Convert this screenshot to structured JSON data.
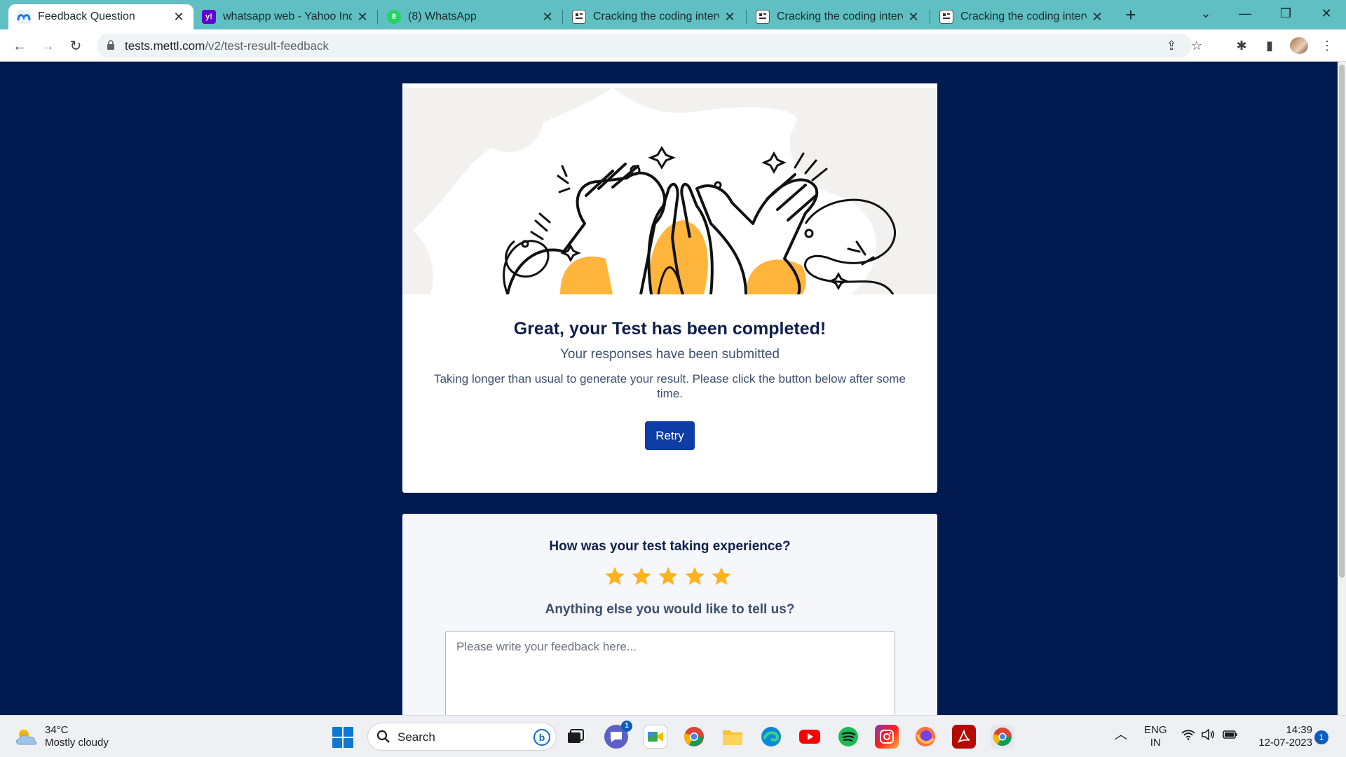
{
  "browser": {
    "tabs": [
      {
        "title": "Feedback Question",
        "active": true,
        "icon": "mettl-icon"
      },
      {
        "title": "whatsapp web - Yahoo India",
        "active": false,
        "icon": "yahoo-icon"
      },
      {
        "title": "(8) WhatsApp",
        "active": false,
        "icon": "whatsapp-icon"
      },
      {
        "title": "Cracking the coding interview",
        "active": false,
        "icon": "document-icon"
      },
      {
        "title": "Cracking the coding interview",
        "active": false,
        "icon": "document-icon"
      },
      {
        "title": "Cracking the coding interview",
        "active": false,
        "icon": "document-icon"
      }
    ],
    "url_host": "tests.mettl.com",
    "url_path": "/v2/test-result-feedback"
  },
  "result_card": {
    "title": "Great, your Test has been completed!",
    "subtitle": "Your responses have been submitted",
    "message": "Taking longer than usual to generate your result. Please click the button below after some time.",
    "retry_label": "Retry"
  },
  "feedback_card": {
    "question": "How was your test taking experience?",
    "rating_max": 5,
    "rating_color": "#ffb21a",
    "prompt": "Anything else you would like to tell us?",
    "placeholder": "Please write your feedback here..."
  },
  "taskbar": {
    "weather_temp": "34°C",
    "weather_desc": "Mostly cloudy",
    "search_label": "Search",
    "chat_badge": "1",
    "lang_top": "ENG",
    "lang_bottom": "IN",
    "time": "14:39",
    "date": "12-07-2023",
    "notifications": "1"
  },
  "colors": {
    "page_bg": "#011b51",
    "accent_button": "#0d3da5",
    "tabbar": "#5fbfc2"
  }
}
